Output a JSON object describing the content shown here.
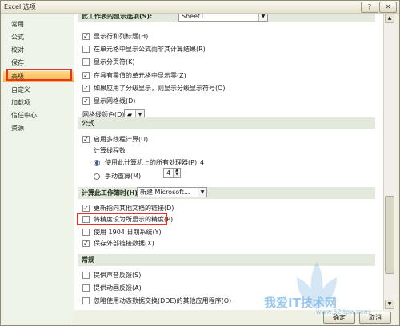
{
  "window": {
    "title": "Excel 选项",
    "help_button": "?",
    "close_button": "✕"
  },
  "sidebar": {
    "items": [
      {
        "label": "常用"
      },
      {
        "label": "公式"
      },
      {
        "label": "校对"
      },
      {
        "label": "保存"
      },
      {
        "label": "高级",
        "selected": true
      },
      {
        "label": "自定义"
      },
      {
        "label": "加载项"
      },
      {
        "label": "信任中心"
      },
      {
        "label": "资源"
      }
    ]
  },
  "display_worksheet": {
    "header_label": "此工作表的显示选项(S):",
    "sheet_dropdown": "Sheet1",
    "options": [
      {
        "label": "显示行和列标题(H)",
        "checked": true
      },
      {
        "label": "在单元格中显示公式而非其计算结果(R)",
        "checked": false
      },
      {
        "label": "显示分页符(K)",
        "checked": false
      },
      {
        "label": "在具有零值的单元格中显示零(Z)",
        "checked": true
      },
      {
        "label": "如果应用了分级显示，则显示分级显示符号(O)",
        "checked": true
      },
      {
        "label": "显示网格线(D)",
        "checked": true
      }
    ],
    "gridline_color_label": "网格线颜色(D)"
  },
  "formulas": {
    "header": "公式",
    "multithread_label": "启用多线程计算(U)",
    "multithread_checked": true,
    "thread_count_label": "计算线程数",
    "use_all_label": "使用此计算机上的所有处理器(P):",
    "use_all_value": "4",
    "manual_label": "手动重算(M)",
    "manual_value": "4"
  },
  "calc_workbook": {
    "header_label": "计算此工作簿时(H):",
    "workbook_dropdown": "新建 Microsoft...",
    "options": [
      {
        "label": "更新指向其他文档的链接(D)",
        "checked": true
      },
      {
        "label": "将精度设为所显示的精度(P)",
        "checked": false
      },
      {
        "label": "使用 1904 日期系统(Y)",
        "checked": false
      },
      {
        "label": "保存外部链接数据(X)",
        "checked": true
      }
    ]
  },
  "general": {
    "header": "常规",
    "options": [
      {
        "label": "提供声音反馈(S)",
        "checked": false
      },
      {
        "label": "提供动画反馈(A)",
        "checked": false
      },
      {
        "label": "忽略使用动态数据交换(DDE)的其他应用程序(O)",
        "checked": false
      }
    ]
  },
  "buttons": {
    "ok": "确定",
    "cancel": "取消"
  },
  "watermark": {
    "text": "我爱IT技术网",
    "url": "www.52itpw.com"
  },
  "colors": {
    "accent_selected": "#fbb03f",
    "highlight_border": "#e2342b"
  }
}
